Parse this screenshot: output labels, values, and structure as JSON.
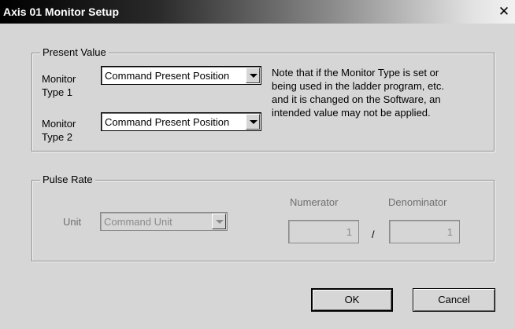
{
  "window": {
    "title": "Axis 01 Monitor Setup",
    "close_glyph": "✕"
  },
  "present_value": {
    "legend": "Present Value",
    "monitor_type_1": {
      "label_line1": "Monitor",
      "label_line2": "Type 1",
      "selected": "Command Present Position"
    },
    "monitor_type_2": {
      "label_line1": "Monitor",
      "label_line2": "Type 2",
      "selected": "Command Present Position"
    },
    "note_lines": [
      "Note that if the Monitor Type is set or",
      "being used in the ladder program, etc.",
      "and it is changed on the Software, an",
      "intended value may not be applied."
    ]
  },
  "pulse_rate": {
    "legend": "Pulse Rate",
    "unit_label": "Unit",
    "unit_selected": "Command Unit",
    "numerator_label": "Numerator",
    "denominator_label": "Denominator",
    "numerator_value": "1",
    "denominator_value": "1",
    "separator": "/"
  },
  "buttons": {
    "ok": "OK",
    "cancel": "Cancel"
  },
  "icons": {
    "combo_arrow": "chevron-down-icon",
    "close": "close-icon"
  }
}
